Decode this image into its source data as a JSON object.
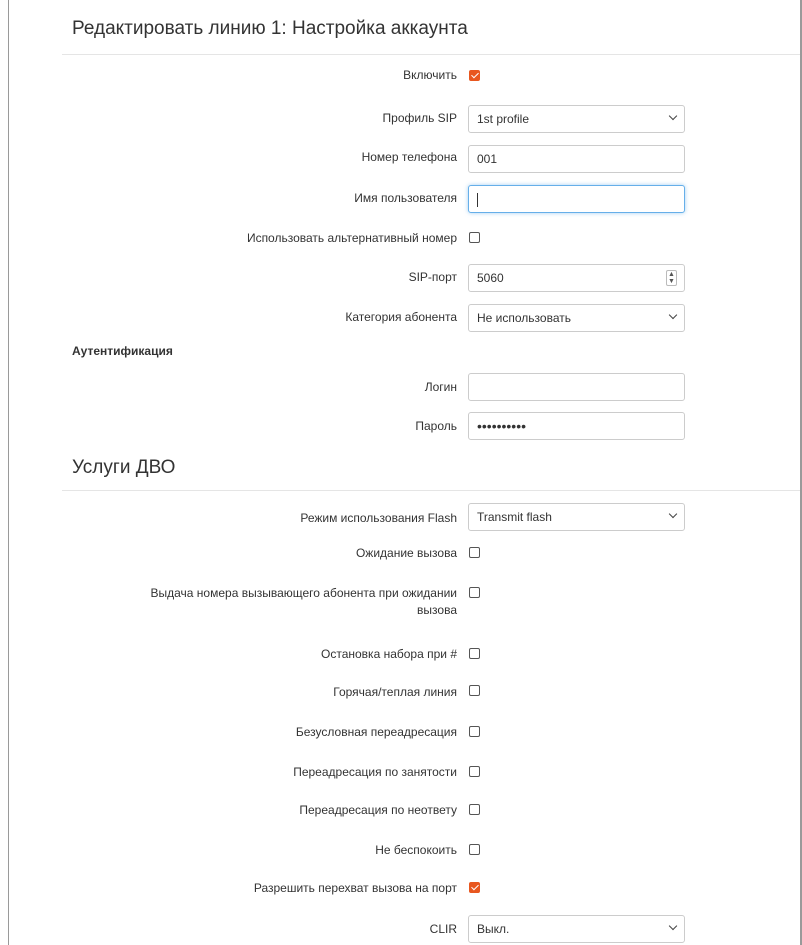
{
  "account": {
    "title": "Редактировать линию 1: Настройка аккаунта",
    "enable": {
      "label": "Включить",
      "checked": true
    },
    "sip_profile": {
      "label": "Профиль SIP",
      "value": "1st profile"
    },
    "phone_number": {
      "label": "Номер телефона",
      "value": "001"
    },
    "username": {
      "label": "Имя пользователя",
      "value": ""
    },
    "alt_number": {
      "label": "Использовать альтернативный номер",
      "checked": false
    },
    "sip_port": {
      "label": "SIP-порт",
      "value": "5060"
    },
    "category": {
      "label": "Категория абонента",
      "value": "Не использовать"
    }
  },
  "auth": {
    "title": "Аутентификация",
    "login": {
      "label": "Логин",
      "value": ""
    },
    "password": {
      "label": "Пароль",
      "value": "••••••••••"
    }
  },
  "services": {
    "title": "Услуги ДВО",
    "flash_mode": {
      "label": "Режим использования Flash",
      "value": "Transmit flash"
    },
    "call_waiting": {
      "label": "Ожидание вызова",
      "checked": false
    },
    "caller_id_waiting": {
      "label_line1": "Выдача номера вызывающего абонента при ожидании",
      "label_line2": "вызова",
      "checked": false
    },
    "stop_dial_hash": {
      "label": "Остановка набора при #",
      "checked": false
    },
    "hotline": {
      "label": "Горячая/теплая линия",
      "checked": false
    },
    "cfu": {
      "label": "Безусловная переадресация",
      "checked": false
    },
    "cfb": {
      "label": "Переадресация по занятости",
      "checked": false
    },
    "cfnr": {
      "label": "Переадресация по неответу",
      "checked": false
    },
    "dnd": {
      "label": "Не беспокоить",
      "checked": false
    },
    "pickup": {
      "label": "Разрешить перехват вызова на порт",
      "checked": true
    },
    "clir": {
      "label": "CLIR",
      "value": "Выкл."
    }
  },
  "colors": {
    "accent": "#e8571f",
    "focus": "#66afe9"
  }
}
